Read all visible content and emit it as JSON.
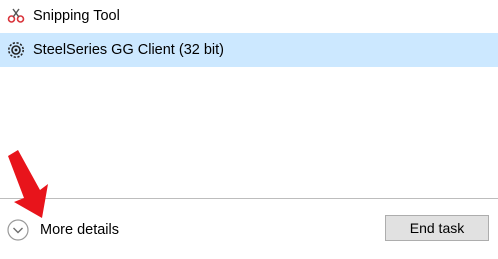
{
  "process_list": {
    "items": [
      {
        "label": "Snipping Tool",
        "icon": "snipping-tool-icon",
        "selected": false
      },
      {
        "label": "SteelSeries GG Client (32 bit)",
        "icon": "steelseries-icon",
        "selected": true
      }
    ]
  },
  "footer": {
    "more_details_label": "More details",
    "more_details_icon": "chevron-down-circle-icon",
    "end_task_label": "End task"
  },
  "annotation": {
    "icon": "red-arrow-icon",
    "color": "#e8141b"
  },
  "colors": {
    "selected_row": "#cce8ff",
    "divider": "#bdbdbd",
    "button_face": "#e1e1e1",
    "button_border": "#adadad"
  }
}
